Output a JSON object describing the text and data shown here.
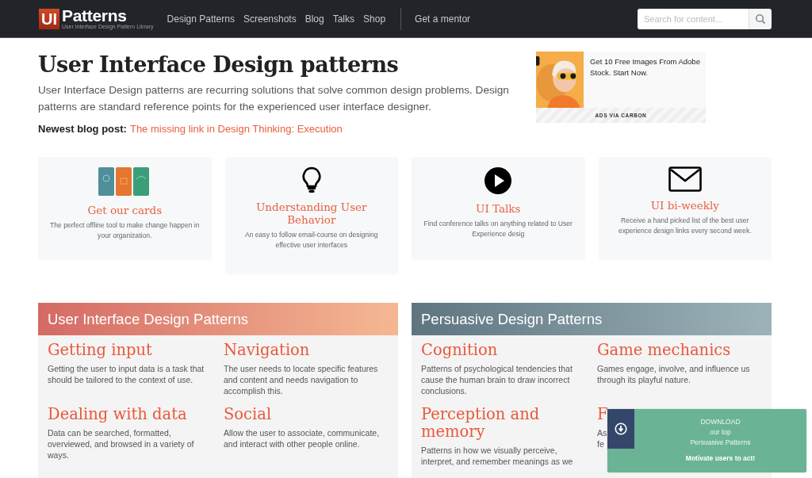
{
  "header": {
    "logo_mark": "UI",
    "logo_text": "Patterns",
    "logo_tagline": "User Interface Design Pattern Library",
    "nav": [
      {
        "label": "Design Patterns"
      },
      {
        "label": "Screenshots"
      },
      {
        "label": "Blog"
      },
      {
        "label": "Talks"
      },
      {
        "label": "Shop"
      }
    ],
    "mentor_link": "Get a mentor",
    "search": {
      "placeholder": "Search for content..."
    }
  },
  "hero": {
    "title": "User Interface Design patterns",
    "intro": "User Interface Design patterns are recurring solutions that solve common design problems. Design patterns are standard reference points for the experienced user interface designer.",
    "blog_label": "Newest blog post:",
    "blog_link": "The missing link in Design Thinking: Execution"
  },
  "ad": {
    "kind": "picture",
    "text": "Get 10 Free Images From Adobe Stock. Start Now.",
    "footer": "ADS VIA CARBON"
  },
  "cards": [
    {
      "kind": "cards",
      "title": "Get our cards",
      "description": "The perfect offline tool to make change happen in your organization."
    },
    {
      "kind": "bulb",
      "title": "Understanding User Behavior",
      "description": "An easy to follow email-course on designing effective user interfaces"
    },
    {
      "kind": "play",
      "title": "UI Talks",
      "description": "Find conference talks on anything related to User Experience desig"
    },
    {
      "kind": "mail",
      "title": "UI bi-weekly",
      "description": "Receive a hand picked list of the best user experience design links every second week."
    }
  ],
  "sections": [
    {
      "kind": "warm",
      "title": "User Interface Design Patterns",
      "items": [
        {
          "title": "Getting input",
          "description": "Getting the user to input data is a task that should be tailored to the context of use."
        },
        {
          "title": "Navigation",
          "description": "The user needs to locate specific features and content and needs navigation to accomplish this."
        },
        {
          "title": "Dealing with data",
          "description": "Data can be searched, formatted, overviewed, and browsed in a variety of ways."
        },
        {
          "title": "Social",
          "description": "Allow the user to associate, communicate, and interact with other people online."
        }
      ]
    },
    {
      "kind": "cool",
      "title": "Persuasive Design Patterns",
      "items": [
        {
          "title": "Cognition",
          "description": "Patterns of psychological tendencies that cause the human brain to draw incorrect conclusions."
        },
        {
          "title": "Game mechanics",
          "description": "Games engage, involve, and influence us through its playful nature."
        },
        {
          "title": "Perception and memory",
          "description": "Patterns in how we visually perceive, interpret, and remember meanings as we"
        },
        {
          "title": "F",
          "description_lines": [
            "As",
            "fe"
          ]
        }
      ]
    }
  ],
  "popup": {
    "line_1": "DOWNLOAD",
    "line_2": "our top",
    "line_3": "Persuasive Patterns",
    "cta": "Motivate users to act!"
  }
}
